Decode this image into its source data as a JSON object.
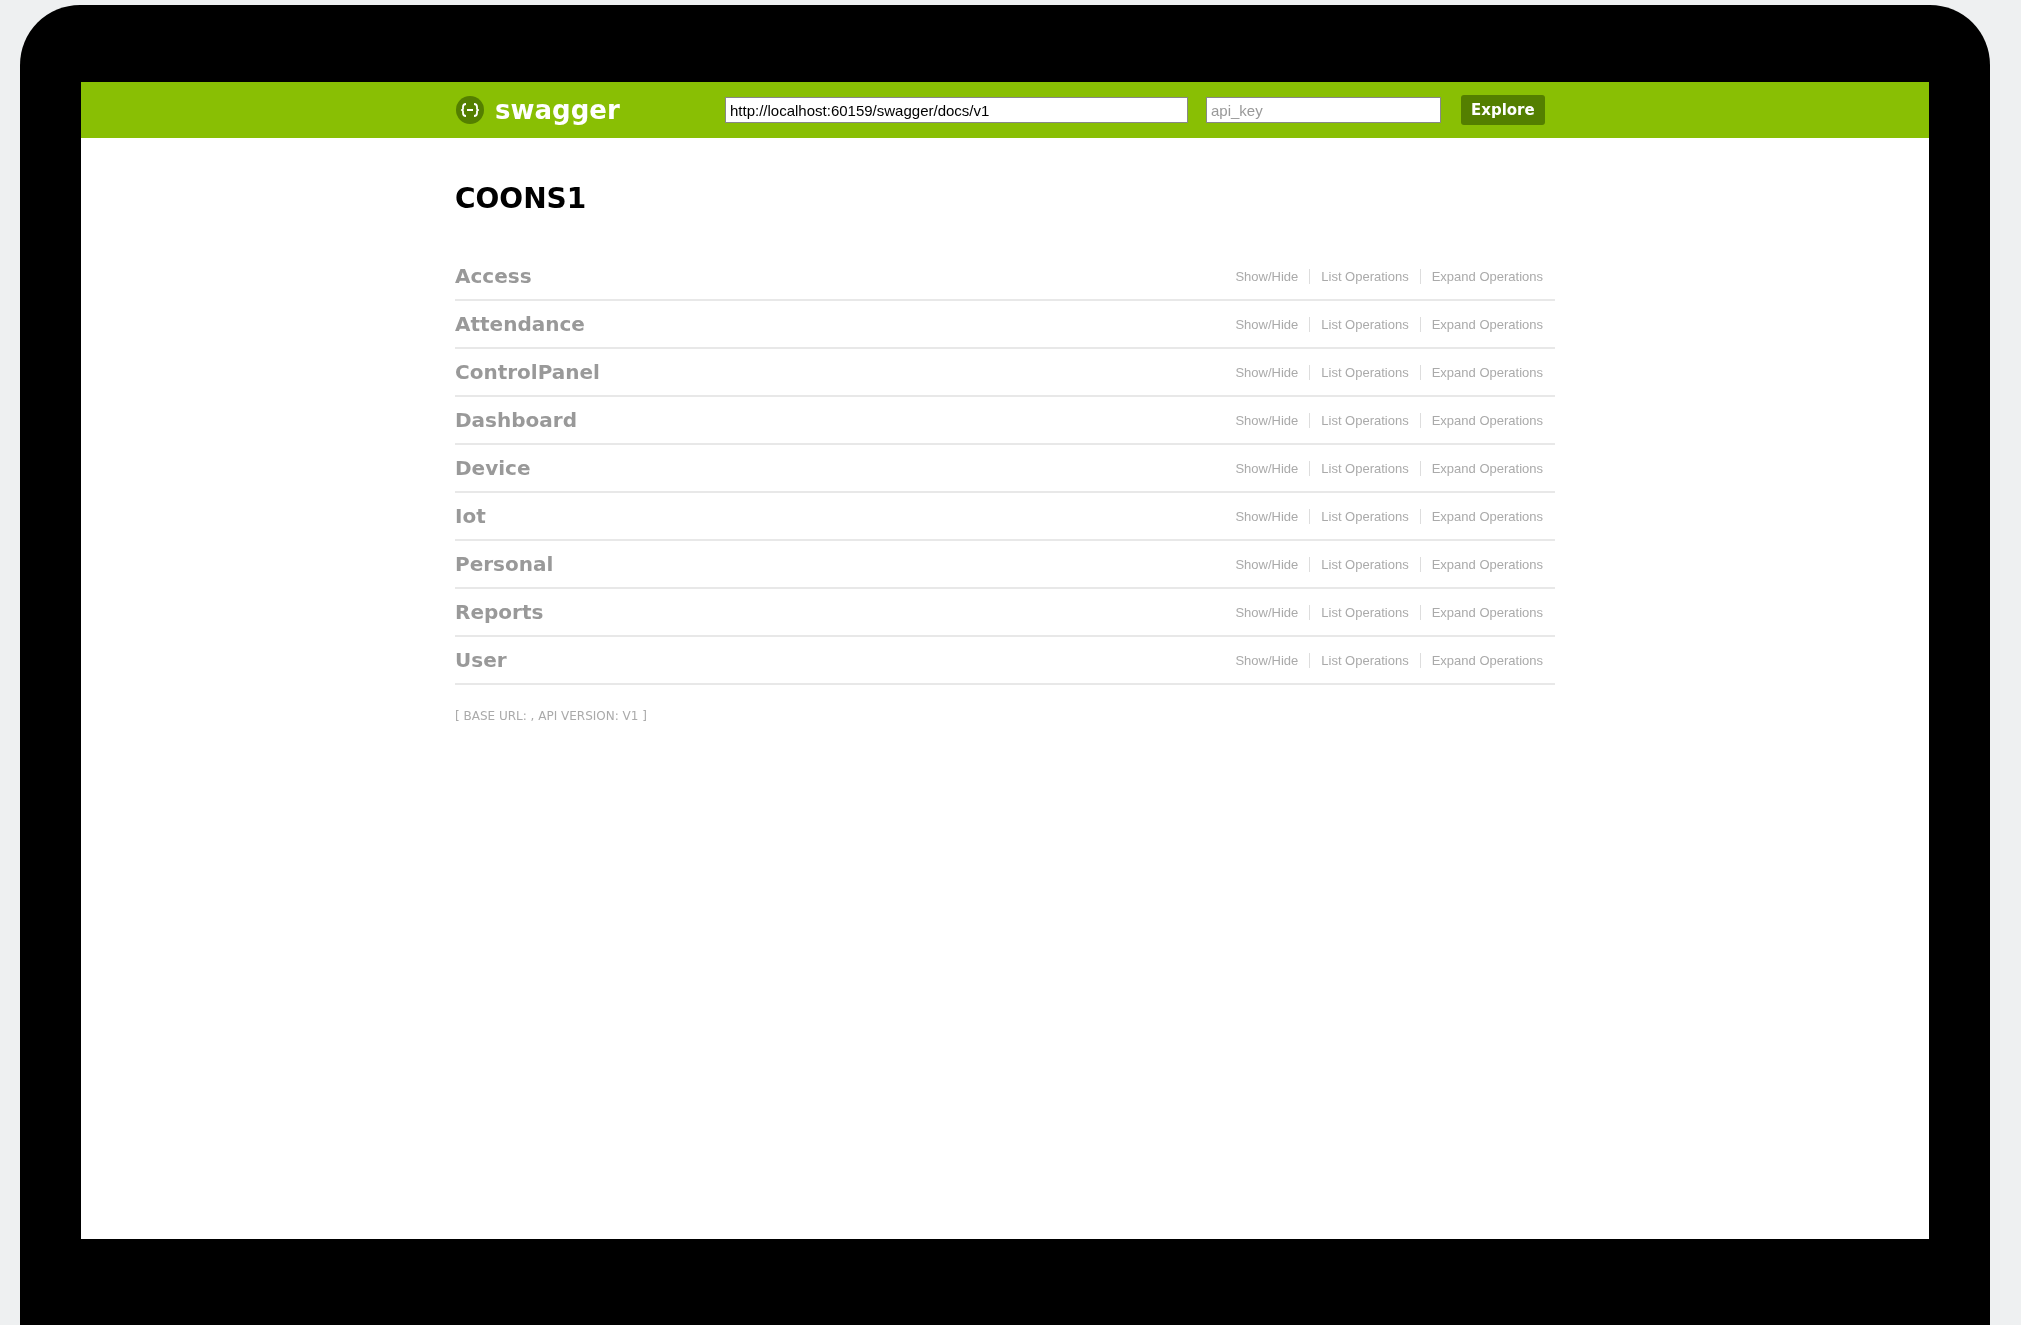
{
  "header": {
    "logo": "swagger",
    "url": "http://localhost:60159/swagger/docs/v1",
    "api_key_placeholder": "api_key",
    "explore": "Explore"
  },
  "title": "COONS1",
  "resources": [
    {
      "name": "Access",
      "actions": [
        "Show/Hide",
        "List Operations",
        "Expand Operations"
      ]
    },
    {
      "name": "Attendance",
      "actions": [
        "Show/Hide",
        "List Operations",
        "Expand Operations"
      ]
    },
    {
      "name": "ControlPanel",
      "actions": [
        "Show/Hide",
        "List Operations",
        "Expand Operations"
      ]
    },
    {
      "name": "Dashboard",
      "actions": [
        "Show/Hide",
        "List Operations",
        "Expand Operations"
      ]
    },
    {
      "name": "Device",
      "actions": [
        "Show/Hide",
        "List Operations",
        "Expand Operations"
      ]
    },
    {
      "name": "Iot",
      "actions": [
        "Show/Hide",
        "List Operations",
        "Expand Operations"
      ]
    },
    {
      "name": "Personal",
      "actions": [
        "Show/Hide",
        "List Operations",
        "Expand Operations"
      ]
    },
    {
      "name": "Reports",
      "actions": [
        "Show/Hide",
        "List Operations",
        "Expand Operations"
      ]
    },
    {
      "name": "User",
      "actions": [
        "Show/Hide",
        "List Operations",
        "Expand Operations"
      ]
    }
  ],
  "footer": "[ BASE URL: , API VERSION: V1 ]"
}
